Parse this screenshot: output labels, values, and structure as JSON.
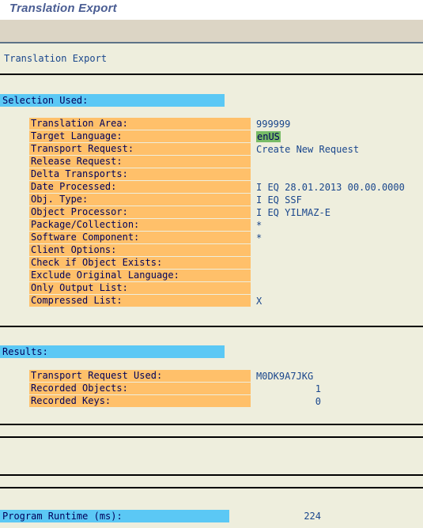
{
  "window": {
    "title": "Translation Export"
  },
  "report": {
    "heading": "Translation Export",
    "selection": {
      "section_label": "Selection Used:",
      "rows": [
        {
          "label": "Translation Area:",
          "value": "999999",
          "highlight": false
        },
        {
          "label": "Target Language:",
          "value": "enUS",
          "highlight": true
        },
        {
          "label": "Transport Request:",
          "value": "Create New Request",
          "highlight": false
        },
        {
          "label": "Release Request:",
          "value": "",
          "highlight": false
        },
        {
          "label": "Delta Transports:",
          "value": "",
          "highlight": false
        },
        {
          "label": "Date Processed:",
          "value": "I EQ 28.01.2013 00.00.0000",
          "highlight": false
        },
        {
          "label": "Obj. Type:",
          "value": "I EQ SSF",
          "highlight": false
        },
        {
          "label": "Object Processor:",
          "value": "I EQ YILMAZ-E",
          "highlight": false
        },
        {
          "label": "Package/Collection:",
          "value": "*",
          "highlight": false
        },
        {
          "label": "Software Component:",
          "value": "*",
          "highlight": false
        },
        {
          "label": "Client Options:",
          "value": "",
          "highlight": false
        },
        {
          "label": "Check if Object Exists:",
          "value": "",
          "highlight": false
        },
        {
          "label": "Exclude Original Language:",
          "value": "",
          "highlight": false
        },
        {
          "label": "Only Output List:",
          "value": "",
          "highlight": false
        },
        {
          "label": "Compressed List:",
          "value": "X",
          "highlight": false
        }
      ]
    },
    "results": {
      "section_label": "Results:",
      "rows": [
        {
          "label": "Transport Request Used:",
          "value": "M0DK9A7JKG",
          "numeric": false
        },
        {
          "label": "Recorded Objects:",
          "value": "1",
          "numeric": true
        },
        {
          "label": "Recorded Keys:",
          "value": "0",
          "numeric": true
        }
      ]
    },
    "footer": {
      "runtime_label": "Program Runtime (ms):",
      "runtime_value": "224"
    }
  },
  "colors": {
    "background": "#eeeedd",
    "titlebar_background": "#ffffff",
    "title_text": "#4a5d93",
    "toolbar_background": "#dcd5c5",
    "toolbar_border": "#5d7387",
    "section_bar": "#5bc8f5",
    "label_cell": "#ffc06a",
    "value_text": "#19468c",
    "highlight_green": "#77bb66",
    "rule": "#000000"
  }
}
